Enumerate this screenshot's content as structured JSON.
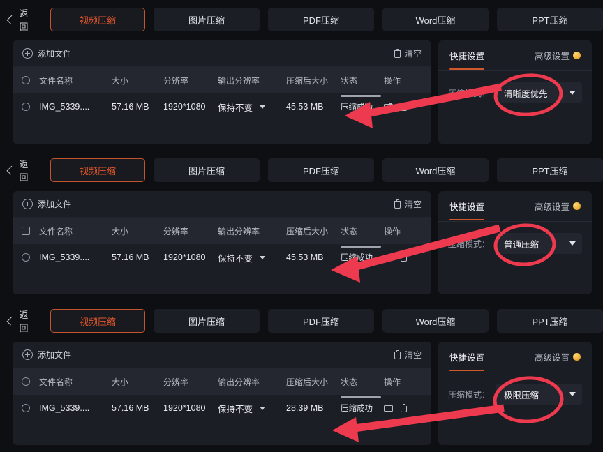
{
  "colors": {
    "background": "#0e0f13",
    "card": "#1b1e25",
    "header_row": "#24272f",
    "accent_orange": "#e3572a",
    "tab_underline": "#d1582b",
    "annotation_red": "#ee3a4e",
    "coin_gold": "#e8a62b",
    "text_primary": "#e7e9ee",
    "text_muted": "#9b9faa"
  },
  "nav": {
    "back_label": "返回",
    "back_icon": "chevron-left-icon",
    "tabs": [
      {
        "label": "视频压缩",
        "active": true
      },
      {
        "label": "图片压缩",
        "active": false
      },
      {
        "label": "PDF压缩",
        "active": false
      },
      {
        "label": "Word压缩",
        "active": false
      },
      {
        "label": "PPT压缩",
        "active": false
      }
    ]
  },
  "files_panel": {
    "add_file_label": "添加文件",
    "add_file_icon": "plus-circle-icon",
    "clear_label": "清空",
    "clear_icon": "trash-icon",
    "columns": [
      "文件名称",
      "大小",
      "分辨率",
      "输出分辨率",
      "压缩后大小",
      "状态",
      "操作"
    ],
    "row": {
      "select_icon": "radio-unchecked-icon",
      "name": "IMG_5339....",
      "size": "57.16 MB",
      "resolution": "1920*1080",
      "output_resolution": "保持不变",
      "output_resolution_caret": "chevron-down-icon",
      "ops": [
        "folder-icon",
        "trash-icon"
      ]
    }
  },
  "settings_panel": {
    "tab_quick": "快捷设置",
    "tab_advanced": "高级设置",
    "advanced_badge_icon": "gold-coin-icon",
    "mode_label": "压缩模式：",
    "dropdown_caret": "chevron-down-icon"
  },
  "sections": [
    {
      "id": "section-clarity-priority",
      "compressed_size": "45.53 MB",
      "status": "压缩成功",
      "mode_value": "清晰度优先"
    },
    {
      "id": "section-normal-compression",
      "compressed_size": "45.53 MB",
      "status": "压缩成功",
      "mode_value": "普通压缩"
    },
    {
      "id": "section-extreme-compression",
      "compressed_size": "28.39 MB",
      "status": "压缩成功",
      "mode_value": "极限压缩"
    }
  ],
  "annotations": [
    {
      "type": "arrow",
      "from": "mode-dropdown",
      "to": "status-cell"
    },
    {
      "type": "ellipse",
      "around": "mode-dropdown"
    }
  ]
}
